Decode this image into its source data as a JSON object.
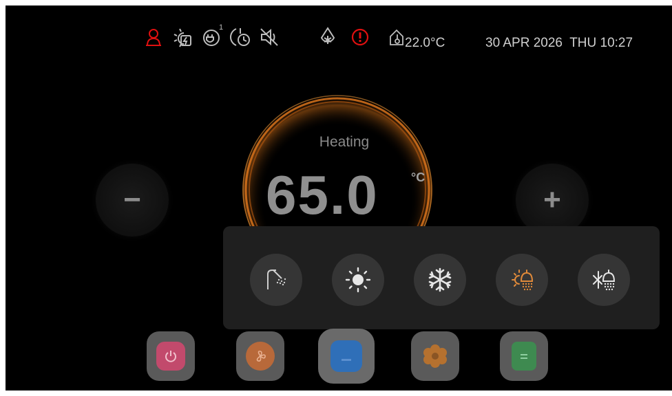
{
  "status_bar": {
    "icons": [
      "person-alert-icon",
      "solar-power-icon",
      "plug-schedule-icon",
      "timer-icon",
      "mute-icon",
      "frost-protect-icon",
      "error-icon"
    ],
    "plug_schedule_index": "1",
    "room_temperature": "22.0°C",
    "datetime": "30 APR 2026  THU 10:27",
    "colors": {
      "alarm": "#e01010",
      "icon": "#bdbdbd"
    }
  },
  "dial": {
    "mode_label": "Heating",
    "setpoint_value": "65.0",
    "setpoint_unit": "°C",
    "decrease_label": "−",
    "increase_label": "+",
    "ring_color": "#e0781a"
  },
  "mode_panel": {
    "options": [
      {
        "name": "hot-water",
        "icon": "shower-icon"
      },
      {
        "name": "heating",
        "icon": "sun-icon"
      },
      {
        "name": "cooling",
        "icon": "snowflake-icon"
      },
      {
        "name": "heating-plus-hot-water",
        "icon": "sun-shower-icon",
        "selected": true
      },
      {
        "name": "cooling-plus-hot-water",
        "icon": "snowflake-shower-icon"
      }
    ],
    "selected_color": "#e08a3a"
  },
  "dock": {
    "items": [
      {
        "name": "power",
        "icon": "power-icon",
        "color": "#d84570"
      },
      {
        "name": "modes",
        "icon": "fan-icon",
        "color": "#d07838"
      },
      {
        "name": "home",
        "icon": "home-icon",
        "color": "#2f6fb8"
      },
      {
        "name": "settings",
        "icon": "gear-icon",
        "color": "#c98535"
      },
      {
        "name": "info",
        "icon": "document-icon",
        "color": "#3e9a54"
      }
    ]
  }
}
